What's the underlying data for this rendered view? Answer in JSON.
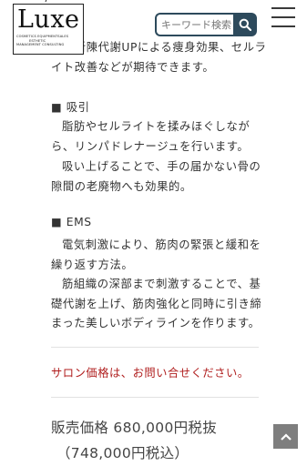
{
  "logo": {
    "wordmark": "Luxe",
    "tagline_lines": [
      "COSMETICS EQUIPMENTSALES",
      "ESTHETIC",
      "MANAGEMENT CONSULTING"
    ]
  },
  "search": {
    "placeholder": "キーワード検索",
    "button_icon": "search-icon"
  },
  "menu": {
    "icon": "hamburger-menu-icon"
  },
  "description": {
    "intro_lines": [
      "める新陳代謝UPによる痩身効果、セルラ",
      "イト改善などが期待できます。"
    ],
    "suction": {
      "heading": "■ 吸引",
      "lines": [
        "脂肪やセルライトを揉みほぐしなが",
        "ら、リンパドレナージュを行います。",
        "吸い上げることで、手の届かない骨の",
        "隙間の老廃物へも効果的。"
      ]
    },
    "ems": {
      "heading": "■ EMS",
      "lines": [
        "電気刺激により、筋肉の緊張と緩和を",
        "繰り返す方法。",
        "筋組織の深部まで刺激することで、基",
        "礎代謝を上げ、筋肉強化と同時に引き締",
        "まった美しいボディラインを作ります。"
      ]
    }
  },
  "salon_price_note": "サロン価格は、お問い合せください。",
  "price": {
    "label": "販売価格 680,000円税抜",
    "tax_included": "（748,000円税込）"
  },
  "back_to_top": {
    "icon": "chevron-up-icon"
  },
  "colors": {
    "search_border": "#2d4a5c",
    "salon_note": "#b01e1e",
    "back_to_top_bg": "#7e7e7e"
  }
}
